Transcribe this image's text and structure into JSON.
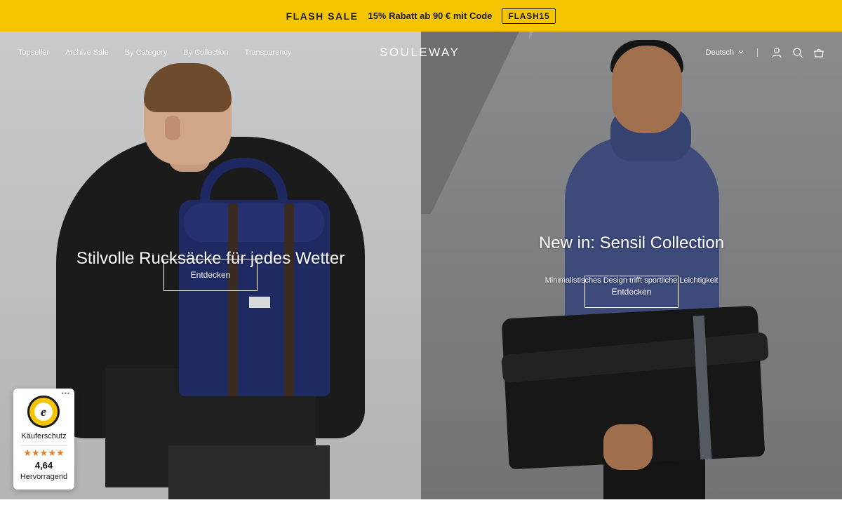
{
  "announcement": {
    "flash": "FLASH SALE",
    "promo": "15% Rabatt ab 90 € mit Code",
    "code": "FLASH15",
    "bg_color": "#f5c500"
  },
  "header": {
    "nav": [
      "Topseller",
      "Archive Sale",
      "By Category",
      "By Collection",
      "Transparency"
    ],
    "logo": "SOULEWAY",
    "language": "Deutsch",
    "icons": [
      "chevron-down-icon",
      "account-icon",
      "search-icon",
      "cart-icon"
    ]
  },
  "hero": {
    "left": {
      "headline": "Stilvolle Rucksäcke für jedes Wetter",
      "cta": "Entdecken"
    },
    "right": {
      "headline": "New in: Sensil Collection",
      "subline": "Minimalistisches Design trifft sportliche Leichtigkeit",
      "cta": "Entdecken"
    }
  },
  "trust_badge": {
    "label": "Käuferschutz",
    "stars": "★★★★★",
    "score": "4,64",
    "rating": "Hervorragend",
    "more": "•••",
    "seal_letter": "e",
    "star_color": "#e67e22"
  }
}
